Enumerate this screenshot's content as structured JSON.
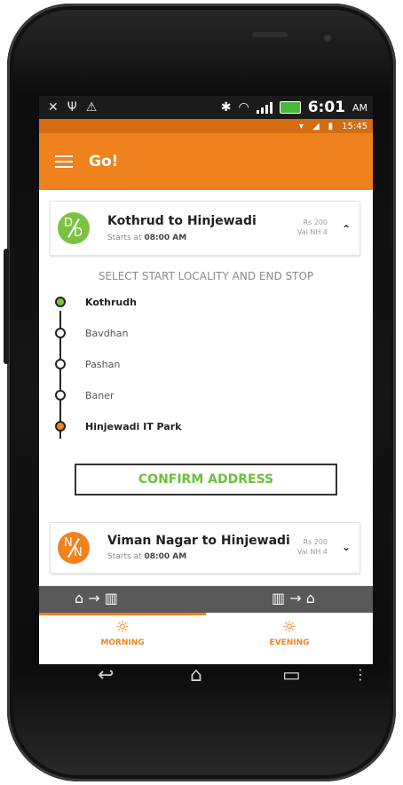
{
  "host_status": {
    "icons_left": [
      "x-icon",
      "usb-icon",
      "warning-icon"
    ],
    "time": "6:01",
    "ampm": "AM"
  },
  "app_status": {
    "time": "15:45"
  },
  "app_bar": {
    "title": "Go!"
  },
  "route1": {
    "avatar_top": "D",
    "avatar_bottom": "D",
    "title": "Kothrud to Hinjewadi",
    "starts_prefix": "Starts at ",
    "starts_time": "08:00 AM",
    "fare": "Rs 200",
    "via": "Vai NH 4",
    "expanded": true
  },
  "section_header": "SELECT START LOCALITY AND END STOP",
  "stops": [
    {
      "name": "Kothrudh",
      "state": "start"
    },
    {
      "name": "Bavdhan",
      "state": "normal"
    },
    {
      "name": "Pashan",
      "state": "normal"
    },
    {
      "name": "Baner",
      "state": "normal"
    },
    {
      "name": "Hinjewadi IT Park",
      "state": "end"
    }
  ],
  "confirm_label": "CONFIRM ADDRESS",
  "route2": {
    "avatar_top": "N",
    "avatar_bottom": "N",
    "title": "Viman Nagar to Hinjewadi",
    "starts_prefix": "Starts at ",
    "starts_time": "08:00 AM",
    "fare": "Rs 200",
    "via": "Vai NH 4",
    "expanded": false
  },
  "tabs": [
    {
      "label": "MORNING",
      "icon": "sunrise-icon",
      "active": true
    },
    {
      "label": "EVENING",
      "icon": "sunset-icon",
      "active": false
    }
  ],
  "colors": {
    "accent": "#f0821e",
    "green": "#7cc242",
    "dark_tab": "#595959"
  }
}
